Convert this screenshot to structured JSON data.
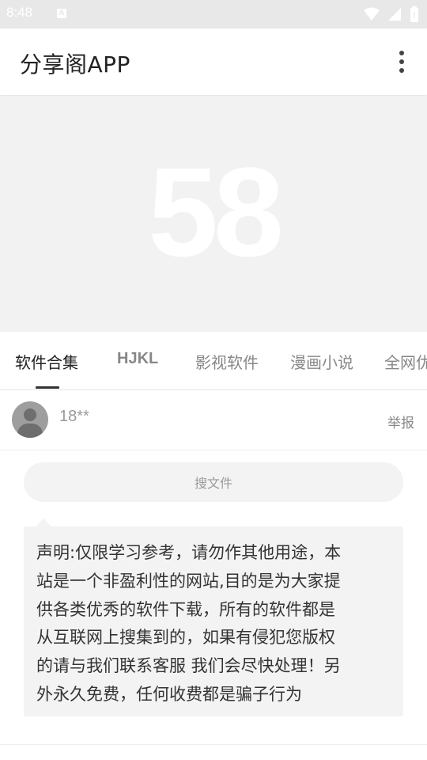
{
  "status_bar": {
    "time": "8:48",
    "notification_icon": "A"
  },
  "app_bar": {
    "title": "分享阁APP",
    "menu_icon": "more-vert-icon"
  },
  "banner": {
    "watermark": "58"
  },
  "tabs": [
    {
      "label": "软件合集",
      "active": true
    },
    {
      "label": "HJKL",
      "active": false
    },
    {
      "label": "影视软件",
      "active": false
    },
    {
      "label": "漫画小说",
      "active": false
    },
    {
      "label": "全网优",
      "active": false
    }
  ],
  "post": {
    "username": "18**",
    "report_label": "举报",
    "search_label": "搜文件",
    "disclaimer_lines": [
      "声明:仅限学习参考，请勿作其他用途，本",
      "站是一个非盈利性的网站,目的是为大家提",
      "供各类优秀的软件下载，所有的软件都是",
      "从互联网上搜集到的，如果有侵犯您版权",
      "的请与我们联系客服 我们会尽快处理！另",
      "外永久免费，任何收费都是骗子行为"
    ]
  }
}
